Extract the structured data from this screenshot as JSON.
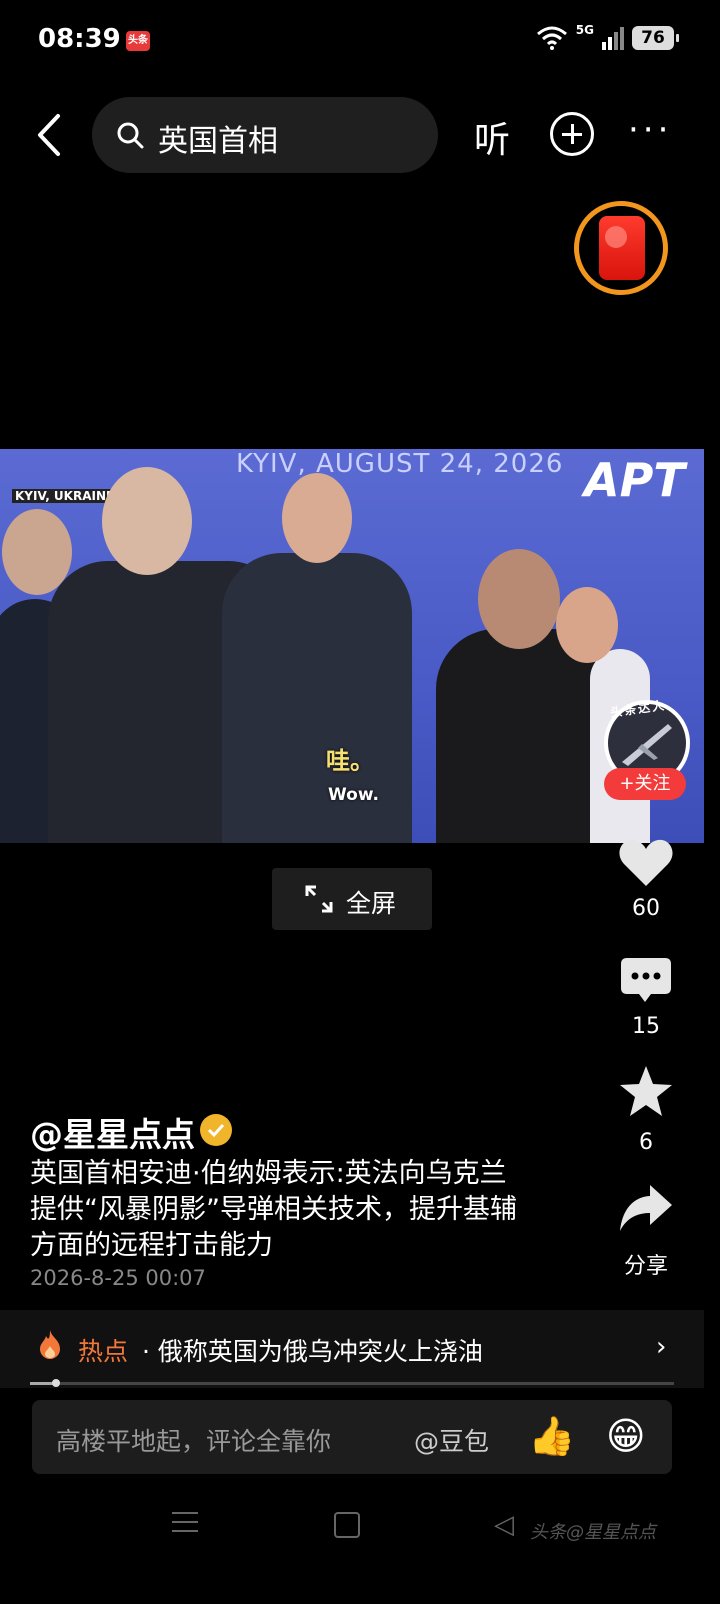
{
  "status_bar": {
    "time": "08:39",
    "app_badge": "头条",
    "network": "5G",
    "battery": "76"
  },
  "top_bar": {
    "search_text": "英国首相",
    "listen_label": "听",
    "more_label": "···"
  },
  "video": {
    "banner_text": "KYIV, AUGUST  24, 2026",
    "logo": "APT",
    "location": "KYIV, UKRAINE",
    "subtitle_cn": "哇。",
    "subtitle_en": "Wow."
  },
  "creator_badge": {
    "label": "头条达人",
    "follow_label": "+关注"
  },
  "fullscreen_label": "全屏",
  "actions": {
    "like_count": "60",
    "comment_count": "15",
    "star_count": "6",
    "share_label": "分享"
  },
  "post": {
    "author": "@星星点点",
    "text": "英国首相安迪·伯纳姆表示:英法向乌克兰提供“风暴阴影”导弹相关技术，提升基辅方面的远程打击能力",
    "time": "2026-8-25 00:07"
  },
  "hot": {
    "label": "热点",
    "text": "· 俄称英国为俄乌冲突火上浇油",
    "progress": 0.04
  },
  "comment_bar": {
    "placeholder": "高楼平地起，评论全靠你",
    "mention": "@豆包",
    "thumb_emoji": "👍",
    "grin_emoji": "😁"
  },
  "watermark": "头条@星星点点",
  "colors": {
    "hot_accent": "#f2783a",
    "follow_red": "#f33b3b",
    "envelope_ring": "#f2961d"
  }
}
